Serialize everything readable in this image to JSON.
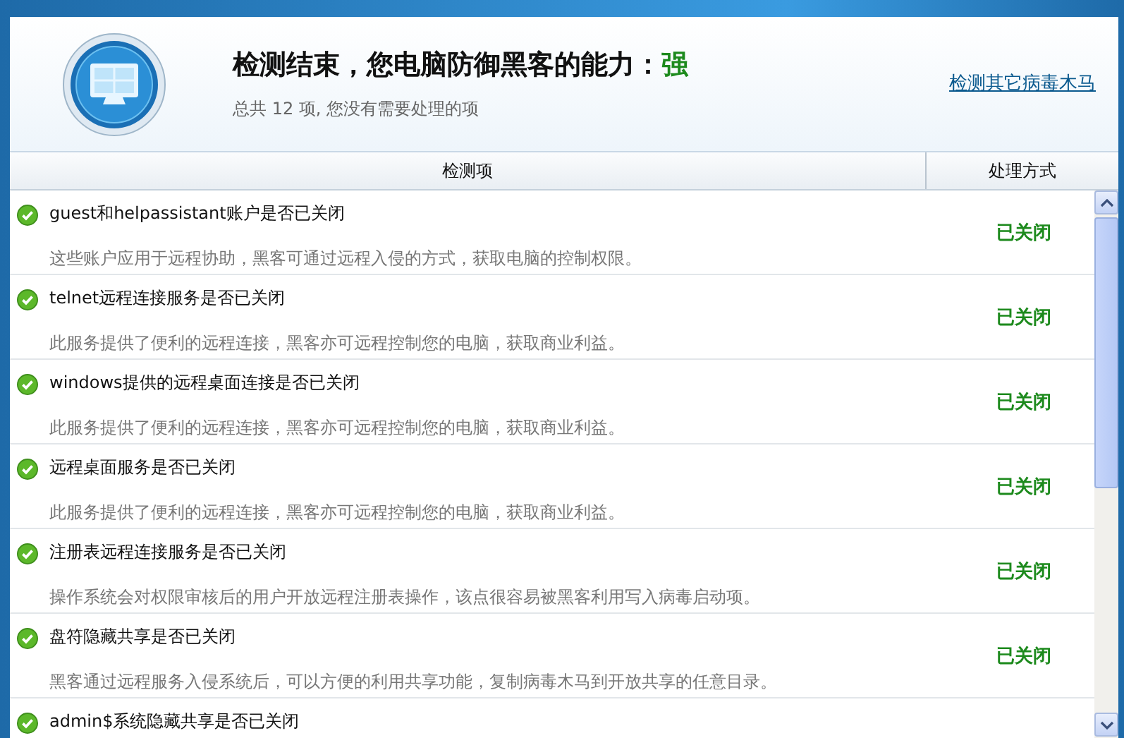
{
  "header": {
    "title": "检测结束，您电脑防御黑客的能力：",
    "rating": "强",
    "summary": "总共 12 项, 您没有需要处理的项",
    "link": "检测其它病毒木马"
  },
  "table": {
    "columns": [
      "检测项",
      "处理方式"
    ],
    "rows": [
      {
        "title": "guest和helpassistant账户是否已关闭",
        "description": "这些账户应用于远程协助，黑客可通过远程入侵的方式，获取电脑的控制权限。",
        "status": "已关闭"
      },
      {
        "title": "telnet远程连接服务是否已关闭",
        "description": "此服务提供了便利的远程连接，黑客亦可远程控制您的电脑，获取商业利益。",
        "status": "已关闭"
      },
      {
        "title": "windows提供的远程桌面连接是否已关闭",
        "description": "此服务提供了便利的远程连接，黑客亦可远程控制您的电脑，获取商业利益。",
        "status": "已关闭"
      },
      {
        "title": "远程桌面服务是否已关闭",
        "description": "此服务提供了便利的远程连接，黑客亦可远程控制您的电脑，获取商业利益。",
        "status": "已关闭"
      },
      {
        "title": "注册表远程连接服务是否已关闭",
        "description": "操作系统会对权限审核后的用户开放远程注册表操作，该点很容易被黑客利用写入病毒启动项。",
        "status": "已关闭"
      },
      {
        "title": "盘符隐藏共享是否已关闭",
        "description": "黑客通过远程服务入侵系统后，可以方便的利用共享功能，复制病毒木马到开放共享的任意目录。",
        "status": "已关闭"
      },
      {
        "title": "admin$系统隐藏共享是否已关闭"
      }
    ]
  }
}
